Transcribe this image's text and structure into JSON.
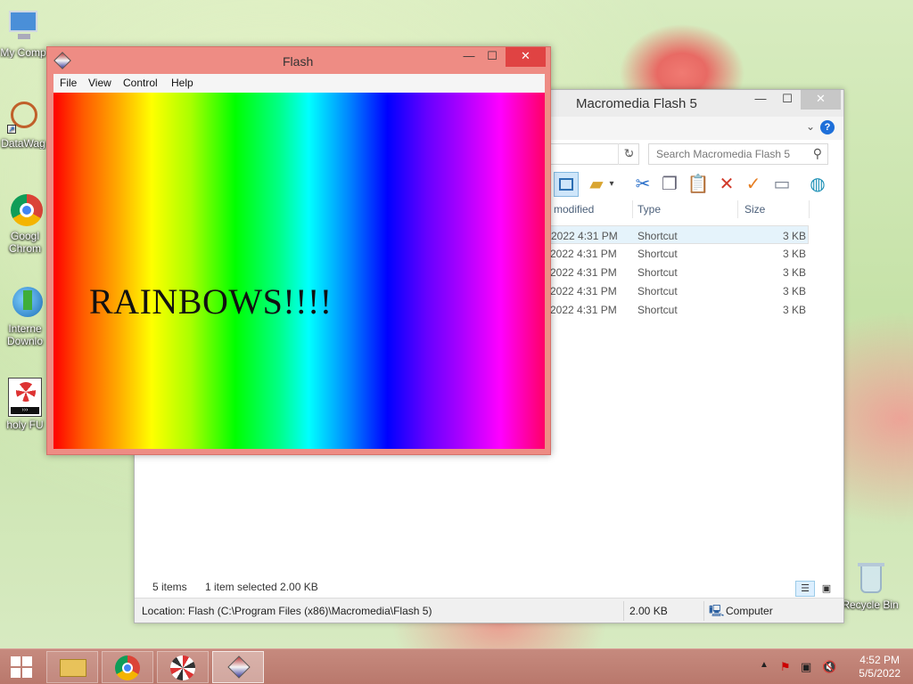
{
  "desktop": {
    "icons": [
      {
        "label": "My Comp",
        "icon": "computer-icon"
      },
      {
        "label": "DataWag",
        "icon": "datawag-icon"
      },
      {
        "label": "Googl",
        "label2": "Chrom",
        "icon": "chrome-icon"
      },
      {
        "label": "Interne",
        "label2": "Downlo",
        "icon": "internet-download-icon"
      },
      {
        "label": "holy FU",
        "icon": "flash-movie-icon"
      },
      {
        "label": "Recycle Bin",
        "icon": "recycle-bin-icon"
      }
    ]
  },
  "explorer": {
    "title": "Macromedia Flash 5",
    "search_placeholder": "Search Macromedia Flash 5",
    "columns": {
      "modified": "modified",
      "type": "Type",
      "size": "Size"
    },
    "rows": [
      {
        "modified": "2022 4:31 PM",
        "type": "Shortcut",
        "size": "3 KB",
        "selected": true
      },
      {
        "modified": "2022 4:31 PM",
        "type": "Shortcut",
        "size": "3 KB"
      },
      {
        "modified": "2022 4:31 PM",
        "type": "Shortcut",
        "size": "3 KB"
      },
      {
        "modified": "2022 4:31 PM",
        "type": "Shortcut",
        "size": "3 KB"
      },
      {
        "modified": "2022 4:31 PM",
        "type": "Shortcut",
        "size": "3 KB"
      }
    ],
    "status": {
      "items": "5 items",
      "selected": "1 item selected  2.00 KB"
    },
    "location": {
      "path": "Location: Flash (C:\\Program Files (x86)\\Macromedia\\Flash 5)",
      "size": "2.00 KB",
      "computer": "Computer"
    }
  },
  "flash": {
    "title": "Flash",
    "menu": [
      "File",
      "View",
      "Control",
      "Help"
    ],
    "stage_text": "RAINBOWS!!!!"
  },
  "window_controls": {
    "minimize": "—",
    "maximize": "☐",
    "close": "✕"
  },
  "taskbar": {
    "apps": [
      "file-explorer-icon",
      "chrome-icon",
      "aperture-app-icon",
      "flash-player-icon"
    ],
    "time": "4:52 PM",
    "date": "5/5/2022"
  }
}
